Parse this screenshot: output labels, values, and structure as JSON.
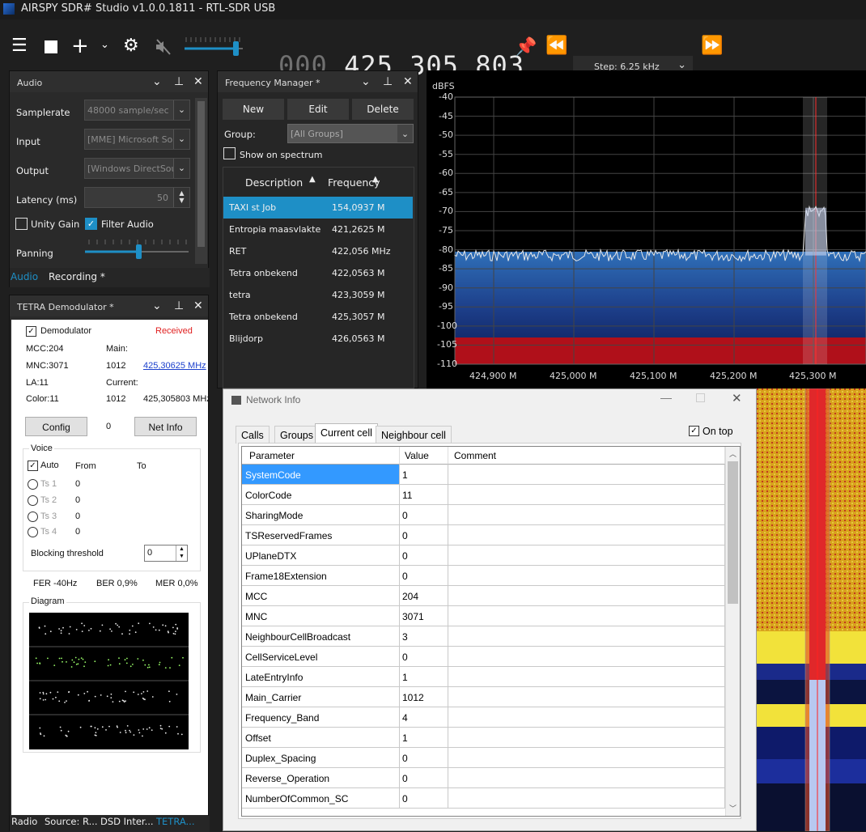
{
  "app": {
    "title": "AIRSPY SDR# Studio v1.0.0.1811 - RTL-SDR USB"
  },
  "toolbar": {
    "freq_dim": "000.",
    "freq_main": "425.305.803",
    "step": "Step: 6.25 kHz",
    "menu_icon": "menu-icon",
    "stop_icon": "stop-icon",
    "add_icon": "plus-icon",
    "gear_icon": "gear-icon",
    "mute_icon": "speaker-muted-icon",
    "volume_level": 0.85
  },
  "audio": {
    "title": "Audio",
    "samplerate_label": "Samplerate",
    "samplerate_value": "48000 sample/sec",
    "input_label": "Input",
    "input_value": "[MME] Microsoft So",
    "output_label": "Output",
    "output_value": "[Windows DirectSou",
    "latency_label": "Latency (ms)",
    "latency_value": "50",
    "unity_gain": "Unity Gain",
    "filter_audio": "Filter Audio",
    "panning": "Panning",
    "tab_audio": "Audio",
    "tab_recording": "Recording *"
  },
  "tetra": {
    "title": "TETRA Demodulator *",
    "demodulator": "Demodulator",
    "received": "Received",
    "mcc": "MCC:204",
    "main": "Main:",
    "mnc": "MNC:3071",
    "main_val": "1012",
    "main_freq": "425,30625 MHz",
    "la": "LA:11",
    "current": "Current:",
    "color": "Color:11",
    "cur_val": "1012",
    "cur_freq": "425,305803 MHz",
    "config": "Config",
    "config_val": "0",
    "netinfo": "Net Info",
    "voice": "Voice",
    "auto": "Auto",
    "from": "From",
    "to": "To",
    "ts": [
      {
        "label": "Ts 1",
        "val": "0"
      },
      {
        "label": "Ts 2",
        "val": "0"
      },
      {
        "label": "Ts 3",
        "val": "0"
      },
      {
        "label": "Ts 4",
        "val": "0"
      }
    ],
    "blocking": "Blocking threshold",
    "blocking_val": "0",
    "fer": "FER -40Hz",
    "ber": "BER 0,9%",
    "mer": "MER 0,0%",
    "diagram": "Diagram"
  },
  "freqman": {
    "title": "Frequency Manager *",
    "new": "New",
    "edit": "Edit",
    "delete": "Delete",
    "group_label": "Group:",
    "group_value": "[All Groups]",
    "show": "Show on spectrum",
    "col_desc": "Description",
    "col_freq": "Frequency",
    "rows": [
      {
        "d": "TAXI st Job",
        "f": "154,0937 M"
      },
      {
        "d": "Entropia maasvlakte",
        "f": "421,2625 M"
      },
      {
        "d": "RET",
        "f": "422,056 MHz"
      },
      {
        "d": "Tetra onbekend",
        "f": "422,0563 M"
      },
      {
        "d": "tetra",
        "f": "423,3059 M"
      },
      {
        "d": "Tetra onbekend",
        "f": "425,3057 M"
      },
      {
        "d": "Blijdorp",
        "f": "426,0563 M"
      }
    ]
  },
  "spectrum": {
    "unit": "dBFS",
    "y": [
      "-40",
      "-45",
      "-50",
      "-55",
      "-60",
      "-65",
      "-70",
      "-75",
      "-80",
      "-85",
      "-90",
      "-95",
      "-100",
      "-105",
      "-110"
    ],
    "x": [
      "424,900 M",
      "425,000 M",
      "425,100 M",
      "425,200 M",
      "425,300 M"
    ]
  },
  "netinfo": {
    "title": "Network Info",
    "tabs": [
      "Calls",
      "Groups",
      "Current cell",
      "Neighbour cell"
    ],
    "ontop": "On top",
    "h_param": "Parameter",
    "h_value": "Value",
    "h_comment": "Comment",
    "rows": [
      {
        "p": "SystemCode",
        "v": "1"
      },
      {
        "p": "ColorCode",
        "v": "11"
      },
      {
        "p": "SharingMode",
        "v": "0"
      },
      {
        "p": "TSReservedFrames",
        "v": "0"
      },
      {
        "p": "UPlaneDTX",
        "v": "0"
      },
      {
        "p": "Frame18Extension",
        "v": "0"
      },
      {
        "p": "MCC",
        "v": "204"
      },
      {
        "p": "MNC",
        "v": "3071"
      },
      {
        "p": "NeighbourCellBroadcast",
        "v": "3"
      },
      {
        "p": "CellServiceLevel",
        "v": "0"
      },
      {
        "p": "LateEntryInfo",
        "v": "1"
      },
      {
        "p": "Main_Carrier",
        "v": "1012"
      },
      {
        "p": "Frequency_Band",
        "v": "4"
      },
      {
        "p": "Offset",
        "v": "1"
      },
      {
        "p": "Duplex_Spacing",
        "v": "0"
      },
      {
        "p": "Reverse_Operation",
        "v": "0"
      },
      {
        "p": "NumberOfCommon_SC",
        "v": "0"
      }
    ]
  },
  "bottom_tabs": [
    "Radio",
    "Source: R...",
    "DSD Inter...",
    "TETRA..."
  ]
}
